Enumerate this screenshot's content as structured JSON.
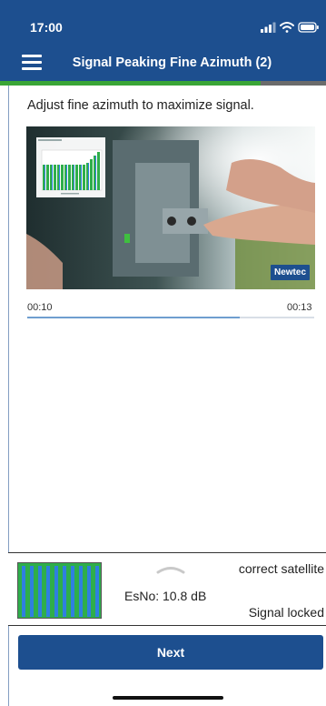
{
  "status_bar": {
    "time": "17:00"
  },
  "header": {
    "title": "Signal Peaking Fine Azimuth (2)",
    "progress_fraction": 0.8
  },
  "instruction": "Adjust fine azimuth to maximize signal.",
  "video": {
    "brand_label": "Newtec",
    "current_time": "00:10",
    "duration": "00:13",
    "played_fraction": 0.74
  },
  "signal_panel": {
    "esno": "EsNo: 10.8 dB",
    "satellite_status": "correct satellite",
    "lock_status": "Signal locked"
  },
  "footer": {
    "next_label": "Next"
  },
  "colors": {
    "primary": "#1d4f8f",
    "progress": "#3aa536",
    "seek": "#6f9ecf",
    "signal_green": "#2fae4a",
    "signal_blue": "#2f7fe0"
  }
}
